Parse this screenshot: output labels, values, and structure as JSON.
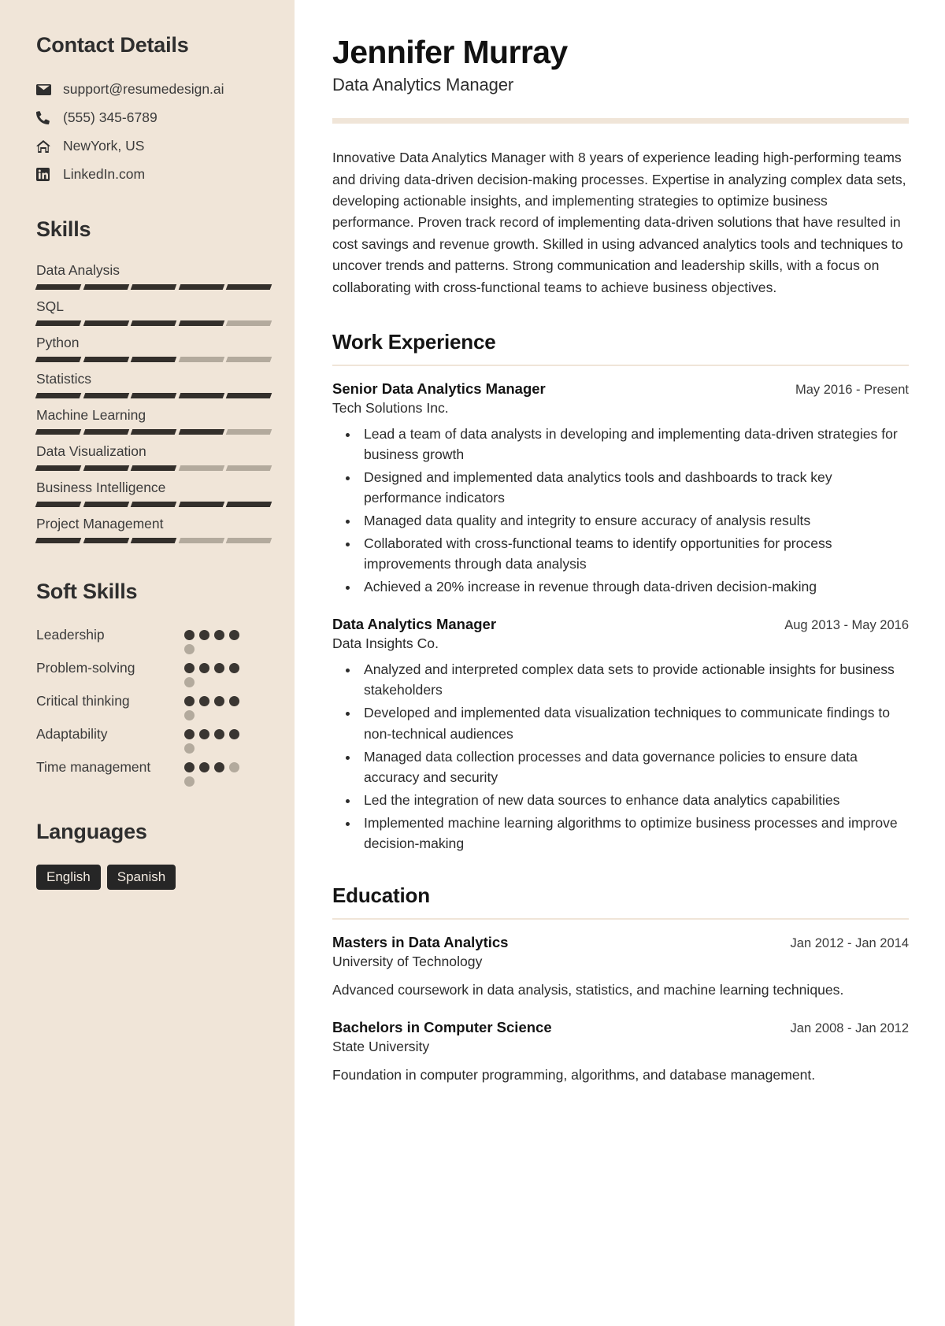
{
  "sidebar": {
    "contact": {
      "heading": "Contact Details",
      "items": [
        {
          "icon": "envelope-icon",
          "value": "support@resumedesign.ai"
        },
        {
          "icon": "phone-icon",
          "value": "(555) 345-6789"
        },
        {
          "icon": "home-icon",
          "value": "NewYork, US"
        },
        {
          "icon": "linkedin-icon",
          "value": "LinkedIn.com"
        }
      ]
    },
    "skills": {
      "heading": "Skills",
      "max": 5,
      "items": [
        {
          "name": "Data Analysis",
          "level": 5
        },
        {
          "name": "SQL",
          "level": 4
        },
        {
          "name": "Python",
          "level": 3
        },
        {
          "name": "Statistics",
          "level": 5
        },
        {
          "name": "Machine Learning",
          "level": 4
        },
        {
          "name": "Data Visualization",
          "level": 3
        },
        {
          "name": "Business Intelligence",
          "level": 5
        },
        {
          "name": "Project Management",
          "level": 3
        }
      ]
    },
    "soft_skills": {
      "heading": "Soft Skills",
      "max": 5,
      "items": [
        {
          "name": "Leadership",
          "level": 4
        },
        {
          "name": "Problem-solving",
          "level": 4
        },
        {
          "name": "Critical thinking",
          "level": 4
        },
        {
          "name": "Adaptability",
          "level": 4
        },
        {
          "name": "Time management",
          "level": 3
        }
      ]
    },
    "languages": {
      "heading": "Languages",
      "items": [
        "English",
        "Spanish"
      ]
    }
  },
  "main": {
    "name": "Jennifer Murray",
    "role": "Data Analytics Manager",
    "summary": "Innovative Data Analytics Manager with 8 years of experience leading high-performing teams and driving data-driven decision-making processes. Expertise in analyzing complex data sets, developing actionable insights, and implementing strategies to optimize business performance. Proven track record of implementing data-driven solutions that have resulted in cost savings and revenue growth. Skilled in using advanced analytics tools and techniques to uncover trends and patterns. Strong communication and leadership skills, with a focus on collaborating with cross-functional teams to achieve business objectives.",
    "work": {
      "heading": "Work Experience",
      "entries": [
        {
          "title": "Senior Data Analytics Manager",
          "company": "Tech Solutions Inc.",
          "date": "May 2016 - Present",
          "bullets": [
            "Lead a team of data analysts in developing and implementing data-driven strategies for business growth",
            "Designed and implemented data analytics tools and dashboards to track key performance indicators",
            "Managed data quality and integrity to ensure accuracy of analysis results",
            "Collaborated with cross-functional teams to identify opportunities for process improvements through data analysis",
            "Achieved a 20% increase in revenue through data-driven decision-making"
          ]
        },
        {
          "title": "Data Analytics Manager",
          "company": "Data Insights Co.",
          "date": "Aug 2013 - May 2016",
          "bullets": [
            "Analyzed and interpreted complex data sets to provide actionable insights for business stakeholders",
            "Developed and implemented data visualization techniques to communicate findings to non-technical audiences",
            "Managed data collection processes and data governance policies to ensure data accuracy and security",
            "Led the integration of new data sources to enhance data analytics capabilities",
            "Implemented machine learning algorithms to optimize business processes and improve decision-making"
          ]
        }
      ]
    },
    "education": {
      "heading": "Education",
      "entries": [
        {
          "title": "Masters in Data Analytics",
          "school": "University of Technology",
          "date": "Jan 2012 - Jan 2014",
          "description": "Advanced coursework in data analysis, statistics, and machine learning techniques."
        },
        {
          "title": "Bachelors in Computer Science",
          "school": "State University",
          "date": "Jan 2008 - Jan 2012",
          "description": "Foundation in computer programming, algorithms, and database management."
        }
      ]
    }
  },
  "colors": {
    "sidebar_bg": "#f0e5d8",
    "bar_on": "#332f2b",
    "bar_off": "#b3aa9d",
    "pill_bg": "#262626",
    "accent_rule": "#f0e5d8"
  }
}
